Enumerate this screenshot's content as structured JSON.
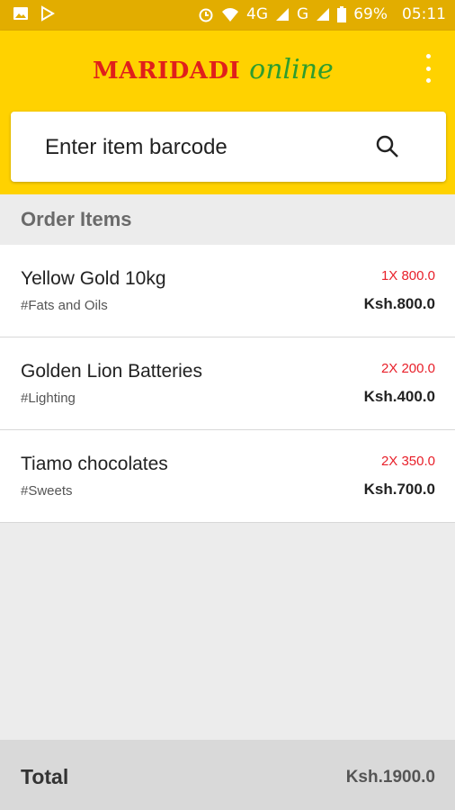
{
  "status_bar": {
    "signal_4g": "4G",
    "signal_g": "G",
    "battery": "69%",
    "time": "05:11",
    "icons": [
      "image-icon",
      "play-store-icon",
      "alarm-icon",
      "wifi-icon",
      "cell-signal-icon",
      "battery-icon"
    ]
  },
  "app_bar": {
    "brand_main": "MARIDADI",
    "brand_sub": "online",
    "menu_icon": "more-vertical-icon"
  },
  "search": {
    "placeholder": "Enter item barcode",
    "icon": "search-icon"
  },
  "order": {
    "header": "Order Items",
    "items": [
      {
        "name": "Yellow Gold 10kg",
        "category": "#Fats and Oils",
        "qty_price": "1X 800.0",
        "total": "Ksh.800.0"
      },
      {
        "name": "Golden Lion Batteries",
        "category": "#Lighting",
        "qty_price": "2X 200.0",
        "total": "Ksh.400.0"
      },
      {
        "name": "Tiamo chocolates",
        "category": "#Sweets",
        "qty_price": "2X 350.0",
        "total": "Ksh.700.0"
      }
    ]
  },
  "footer": {
    "label": "Total",
    "value": "Ksh.1900.0"
  },
  "colors": {
    "appbar": "#ffd200",
    "statusbar": "#e2ad00",
    "brand_red": "#e0201b",
    "brand_green": "#2e9d2e",
    "qty_red": "#e8202a"
  }
}
